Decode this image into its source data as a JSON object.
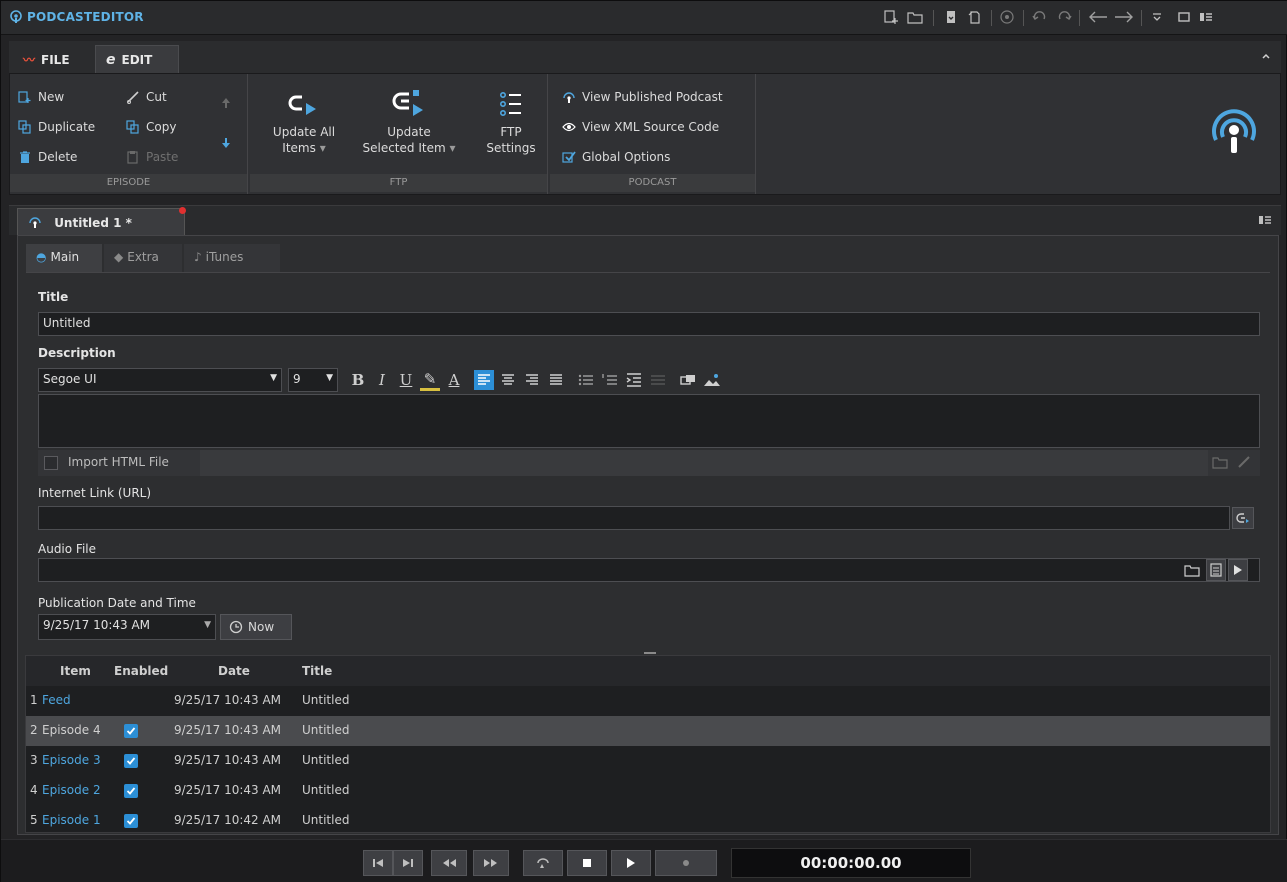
{
  "app": {
    "title": "PODCASTEDITOR"
  },
  "ribbon_tabs": [
    {
      "label": "FILE"
    },
    {
      "label": "EDIT"
    }
  ],
  "ribbon": {
    "episode_group": {
      "label": "EPISODE",
      "new": "New",
      "duplicate": "Duplicate",
      "delete": "Delete",
      "cut": "Cut",
      "copy": "Copy",
      "paste": "Paste"
    },
    "ftp_group": {
      "label": "FTP",
      "update_all_line1": "Update All",
      "update_all_line2": "Items",
      "update_selected_line1": "Update",
      "update_selected_line2": "Selected Item",
      "ftp_settings_line1": "FTP",
      "ftp_settings_line2": "Settings"
    },
    "podcast_group": {
      "label": "PODCAST",
      "view_published": "View Published Podcast",
      "view_xml": "View XML Source Code",
      "global_options": "Global Options"
    }
  },
  "doc_tab": {
    "label": "Untitled 1 *"
  },
  "sub_tabs": [
    {
      "label": "Main"
    },
    {
      "label": "Extra"
    },
    {
      "label": "iTunes"
    }
  ],
  "form": {
    "title_label": "Title",
    "title_value": "Untitled",
    "description_label": "Description",
    "font_name": "Segoe UI",
    "font_size": "9",
    "import_html_label": "Import HTML File",
    "url_label": "Internet Link (URL)",
    "audio_label": "Audio File",
    "pubdate_label": "Publication Date and Time",
    "pubdate_value": "9/25/17 10:43 AM",
    "now_button": "Now"
  },
  "table": {
    "headers": {
      "item": "Item",
      "enabled": "Enabled",
      "date": "Date",
      "title": "Title"
    },
    "rows": [
      {
        "num": "1",
        "item": "Feed",
        "enabled": false,
        "date": "9/25/17 10:43 AM",
        "title": "Untitled",
        "selected": false
      },
      {
        "num": "2",
        "item": "Episode 4",
        "enabled": true,
        "date": "9/25/17 10:43 AM",
        "title": "Untitled",
        "selected": true
      },
      {
        "num": "3",
        "item": "Episode 3",
        "enabled": true,
        "date": "9/25/17 10:43 AM",
        "title": "Untitled",
        "selected": false
      },
      {
        "num": "4",
        "item": "Episode 2",
        "enabled": true,
        "date": "9/25/17 10:43 AM",
        "title": "Untitled",
        "selected": false
      },
      {
        "num": "5",
        "item": "Episode 1",
        "enabled": true,
        "date": "9/25/17 10:42 AM",
        "title": "Untitled",
        "selected": false
      }
    ]
  },
  "transport": {
    "time": "00:00:00.00"
  },
  "colors": {
    "accent": "#2c8fd6",
    "link": "#4ea6df",
    "title": "#5fb3e6"
  }
}
